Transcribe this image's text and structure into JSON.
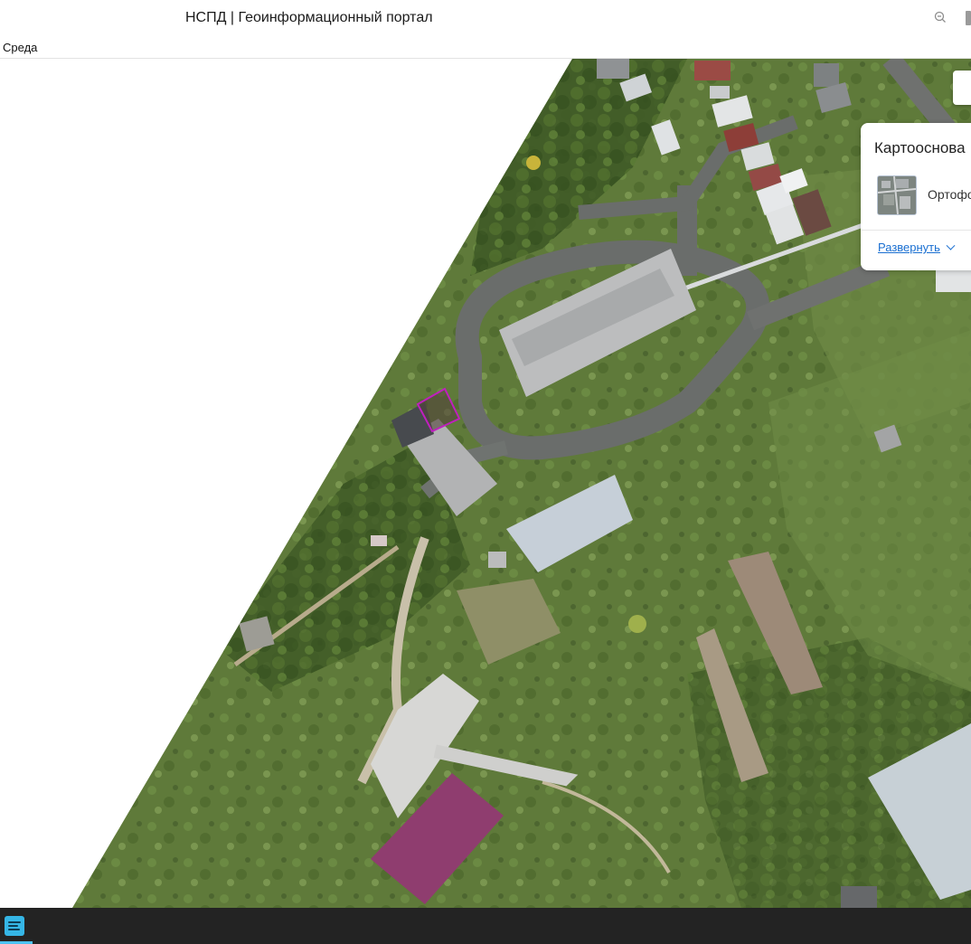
{
  "window": {
    "title": "НСПД | Геоинформационный портал"
  },
  "menubar": {
    "items": [
      "Среда"
    ]
  },
  "layer_panel": {
    "title": "Картооснова",
    "layers": [
      {
        "label": "Ортофотоплан",
        "selected": true
      }
    ],
    "expand_label": "Развернуть"
  },
  "colors": {
    "accent_link": "#1a6fd1",
    "taskbar_bg": "#232323",
    "taskbar_icon": "#35b6e6",
    "parcel_outline": "#c01fbf"
  },
  "icons": {
    "zoom": "zoom-out-icon",
    "taskbar_app": "notepad-app-icon",
    "expand": "chevron-down-icon"
  }
}
